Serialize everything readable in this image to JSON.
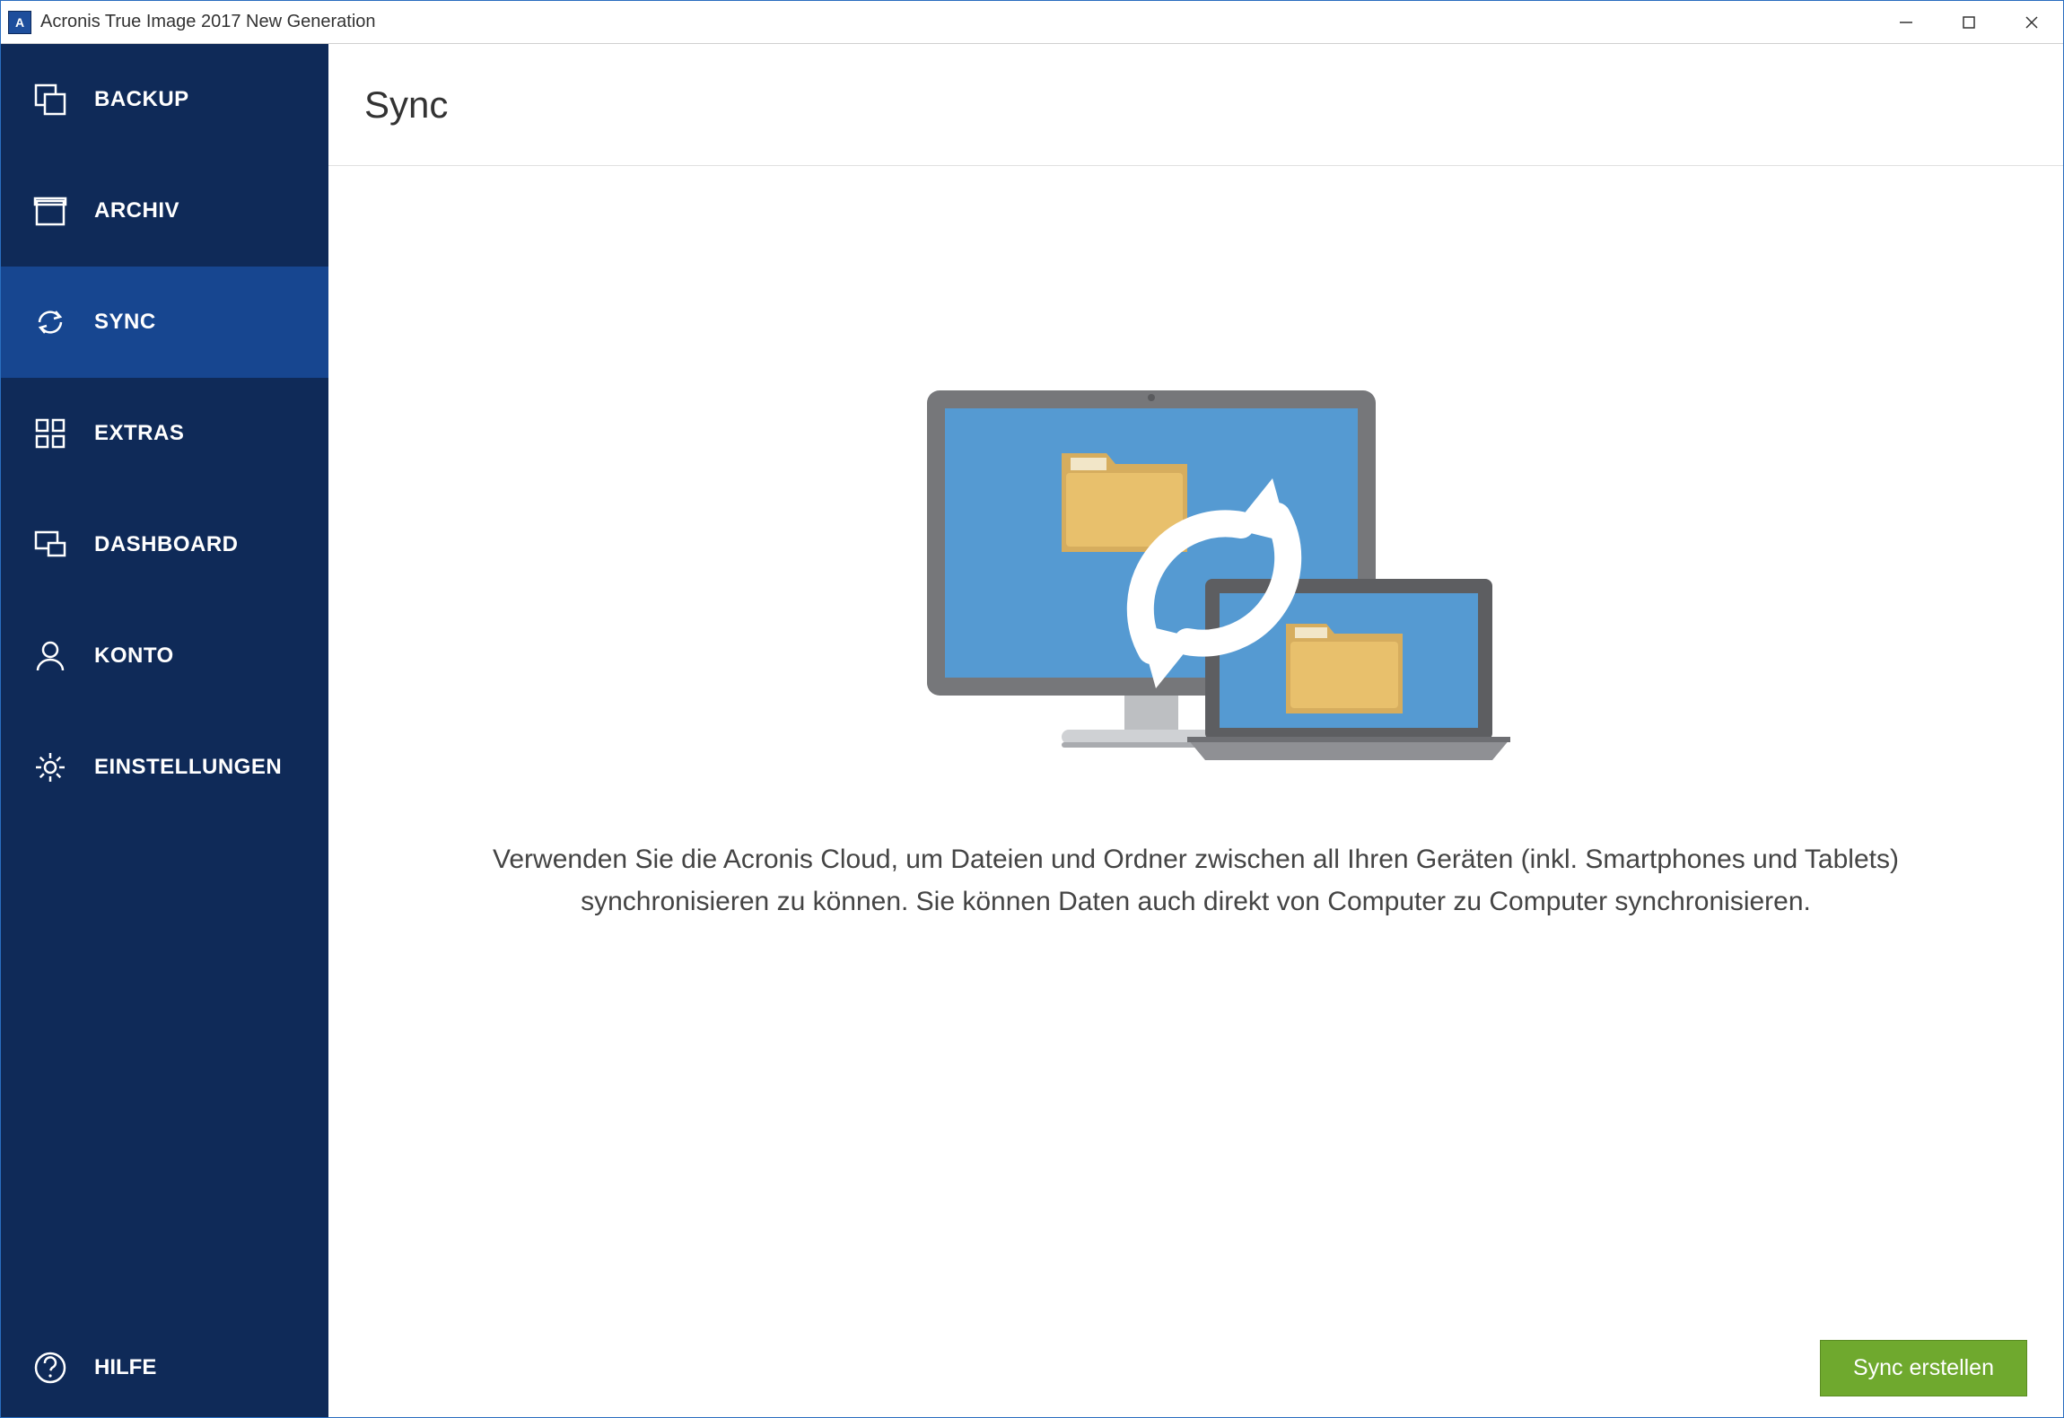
{
  "window": {
    "title": "Acronis True Image 2017 New Generation"
  },
  "sidebar": {
    "items": [
      {
        "label": "BACKUP",
        "icon": "backup"
      },
      {
        "label": "ARCHIV",
        "icon": "archive"
      },
      {
        "label": "SYNC",
        "icon": "sync"
      },
      {
        "label": "EXTRAS",
        "icon": "extras"
      },
      {
        "label": "DASHBOARD",
        "icon": "dashboard"
      },
      {
        "label": "KONTO",
        "icon": "account"
      },
      {
        "label": "EINSTELLUNGEN",
        "icon": "settings"
      }
    ],
    "help_label": "HILFE"
  },
  "main": {
    "title": "Sync",
    "description": "Verwenden Sie die Acronis Cloud, um Dateien und Ordner zwischen all Ihren Geräten (inkl. Smartphones und Tablets) synchronisieren zu können. Sie können Daten auch direkt von Computer zu Computer synchronisieren.",
    "create_button": "Sync erstellen"
  }
}
